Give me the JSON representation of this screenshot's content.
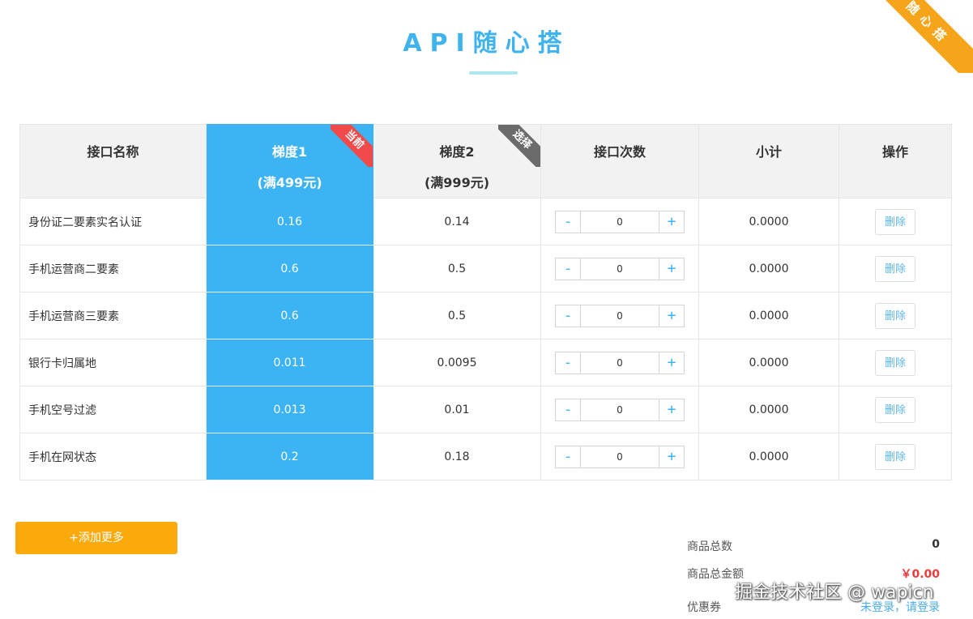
{
  "page": {
    "title": "API随心搭",
    "corner_ribbon": "随心搭"
  },
  "table": {
    "headers": {
      "name": "接口名称",
      "tier1": "梯度1",
      "tier1_sub": "(满499元)",
      "tier1_badge": "当前",
      "tier2": "梯度2",
      "tier2_sub": "(满999元)",
      "tier2_badge": "选择",
      "count": "接口次数",
      "subtotal": "小计",
      "action": "操作"
    },
    "rows": [
      {
        "name": "身份证二要素实名认证",
        "tier1": "0.16",
        "tier2": "0.14",
        "count": "0",
        "subtotal": "0.0000",
        "action": "删除"
      },
      {
        "name": "手机运营商二要素",
        "tier1": "0.6",
        "tier2": "0.5",
        "count": "0",
        "subtotal": "0.0000",
        "action": "删除"
      },
      {
        "name": "手机运营商三要素",
        "tier1": "0.6",
        "tier2": "0.5",
        "count": "0",
        "subtotal": "0.0000",
        "action": "删除"
      },
      {
        "name": "银行卡归属地",
        "tier1": "0.011",
        "tier2": "0.0095",
        "count": "0",
        "subtotal": "0.0000",
        "action": "删除"
      },
      {
        "name": "手机空号过滤",
        "tier1": "0.013",
        "tier2": "0.01",
        "count": "0",
        "subtotal": "0.0000",
        "action": "删除"
      },
      {
        "name": "手机在网状态",
        "tier1": "0.2",
        "tier2": "0.18",
        "count": "0",
        "subtotal": "0.0000",
        "action": "删除"
      }
    ],
    "stepper": {
      "minus": "-",
      "plus": "+"
    }
  },
  "actions": {
    "add_more": "+添加更多"
  },
  "summary": {
    "total_items_label": "商品总数",
    "total_items_value": "0",
    "total_amount_label": "商品总金额",
    "total_amount_value": "￥0.00",
    "coupon_label": "优惠券",
    "coupon_value": "未登录，请登录"
  },
  "watermark": "掘金技术社区 @ wapicn",
  "colors": {
    "accent": "#3cb3f2",
    "title": "#3fb3ee",
    "add_button": "#fbaa0c",
    "current_badge": "#f24a4a",
    "select_badge": "#6b6b6b",
    "money": "#f23a3a"
  }
}
